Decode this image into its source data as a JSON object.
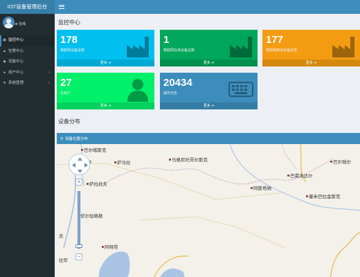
{
  "brand": {
    "title": "IOT设备管理后台"
  },
  "user": {
    "status": "在线"
  },
  "sidebar": {
    "items": [
      {
        "label": "监控中心",
        "icon": "dashboard-icon",
        "active": true
      },
      {
        "label": "告警中心",
        "icon": "bell-icon"
      },
      {
        "label": "设备中心",
        "icon": "devices-icon"
      },
      {
        "label": "用户中心",
        "icon": "user-icon",
        "has_children": true
      },
      {
        "label": "系统管理",
        "icon": "gear-icon",
        "has_children": true
      }
    ]
  },
  "monitor": {
    "title": "监控中心"
  },
  "tiles": [
    {
      "value": "178",
      "label": "物联网设备总数",
      "footer": "更多",
      "color": "#00c0ef",
      "icon": "factory-icon"
    },
    {
      "value": "1",
      "label": "物联网在线设备总数",
      "footer": "更多",
      "color": "#00a65a",
      "icon": "factory-icon"
    },
    {
      "value": "177",
      "label": "物联网离线设备总数",
      "footer": "更多",
      "color": "#f39c12",
      "icon": "factory-icon"
    },
    {
      "value": "27",
      "label": "总用户",
      "footer": "更多",
      "color": "#00f06a",
      "icon": "person-icon"
    },
    {
      "value": "20434",
      "label": "操作日志",
      "footer": "更多",
      "color": "#3c8dbc",
      "icon": "keyboard-icon"
    }
  ],
  "distribution": {
    "title": "设备分布",
    "panel_title": "设备位置分布"
  },
  "map": {
    "cities": [
      {
        "name": "巴尔喀什",
        "partial": "巴尔喀什"
      },
      {
        "name": "萨马拉"
      },
      {
        "name": "马格尼托哥尔斯克"
      },
      {
        "name": "巴尔瑙尔"
      },
      {
        "name": "巴甫洛达尔"
      },
      {
        "name": "萨拉托夫"
      },
      {
        "name": "阿斯塔纳"
      },
      {
        "name": "塞米巴拉金斯克"
      },
      {
        "name": "伏尔加格勒"
      },
      {
        "name": "阿克托别"
      },
      {
        "name": "阿特劳"
      },
      {
        "name": "特拉罕"
      },
      {
        "name": "阿斯特拉罕"
      }
    ]
  },
  "visible_labels": {
    "c1": "巴尔喀斯克",
    "c2": "萨",
    "c3": "萨马拉",
    "c4": "马格尼托哥尔斯克",
    "c5": "巴尔瑙尔",
    "c6": "巴甫洛达尔",
    "c7": "萨拉托夫",
    "c8": "阿斯塔纳",
    "c9": "塞米巴拉金斯克",
    "c10": "伏尔加格勒",
    "c11": "夫",
    "c12": "阿特劳",
    "c13": "拉罕"
  }
}
